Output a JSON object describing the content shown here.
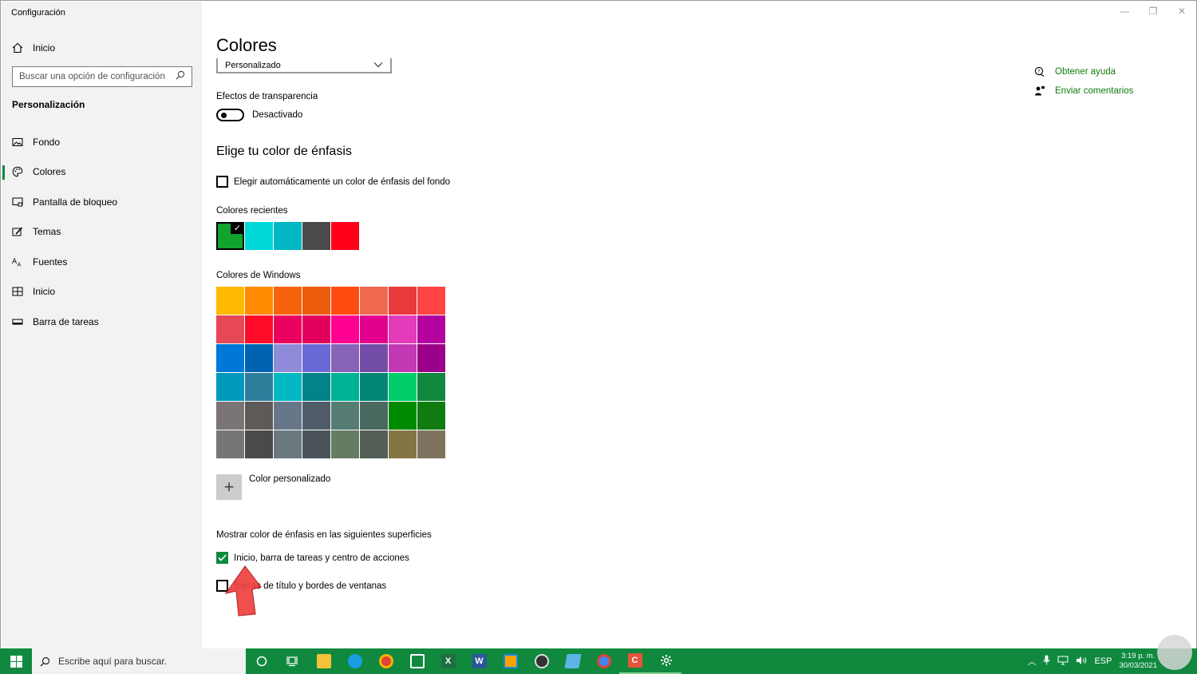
{
  "window": {
    "app_title": "Configuración",
    "controls": {
      "minimize": "—",
      "restore": "❐",
      "close": "✕"
    }
  },
  "sidebar": {
    "home_label": "Inicio",
    "search_placeholder": "Buscar una opción de configuración",
    "section_title": "Personalización",
    "items": [
      {
        "label": "Fondo",
        "icon": "image-icon"
      },
      {
        "label": "Colores",
        "icon": "palette-icon",
        "active": true
      },
      {
        "label": "Pantalla de bloqueo",
        "icon": "lock-screen-icon"
      },
      {
        "label": "Temas",
        "icon": "brush-icon"
      },
      {
        "label": "Fuentes",
        "icon": "font-icon"
      },
      {
        "label": "Inicio",
        "icon": "start-tiles-icon"
      },
      {
        "label": "Barra de tareas",
        "icon": "taskbar-icon"
      }
    ]
  },
  "main": {
    "title": "Colores",
    "color_mode_value": "Personalizado",
    "transparency_label": "Efectos de transparencia",
    "transparency_state": "Desactivado",
    "accent_heading": "Elige tu color de énfasis",
    "auto_accent_label": "Elegir automáticamente un color de énfasis del fondo",
    "recent_colors_label": "Colores recientes",
    "recent_colors": [
      "#10a330",
      "#00d8d8",
      "#00b7c3",
      "#4c4a48",
      "#ff0019"
    ],
    "windows_colors_label": "Colores de Windows",
    "windows_colors": [
      "#ffb900",
      "#ff8c00",
      "#f7630c",
      "#ea5b0c",
      "#ff4b0f",
      "#ef6950",
      "#e83a3a",
      "#ff4343",
      "#e74856",
      "#ff0a29",
      "#ea005e",
      "#e3005c",
      "#ff0090",
      "#e3008c",
      "#e33bba",
      "#b4009e",
      "#0078d7",
      "#0063b1",
      "#8e8cd8",
      "#6b69d6",
      "#8764b8",
      "#744da9",
      "#c239b3",
      "#9a0089",
      "#0099bc",
      "#2d7d9a",
      "#00b7c3",
      "#038387",
      "#00b294",
      "#018574",
      "#00cc6a",
      "#10893e",
      "#7a7574",
      "#5d5a58",
      "#68768a",
      "#515c6b",
      "#567c73",
      "#486860",
      "#008a00",
      "#107c10",
      "#767676",
      "#4c4a48",
      "#69797e",
      "#4a5459",
      "#647c64",
      "#525e54",
      "#847545",
      "#7e735f"
    ],
    "custom_color_label": "Color personalizado",
    "surfaces_label": "Mostrar color de énfasis en las siguientes superficies",
    "surface_start_label": "Inicio, barra de tareas y centro de acciones",
    "surface_titlebar_label": "Barras de título y bordes de ventanas"
  },
  "help": {
    "get_help": "Obtener ayuda",
    "feedback": "Enviar comentarios"
  },
  "taskbar": {
    "search_placeholder": "Escribe aquí para buscar.",
    "language": "ESP",
    "time": "3:19 p. m.",
    "date": "30/03/2021",
    "accent_color": "#10893e"
  }
}
